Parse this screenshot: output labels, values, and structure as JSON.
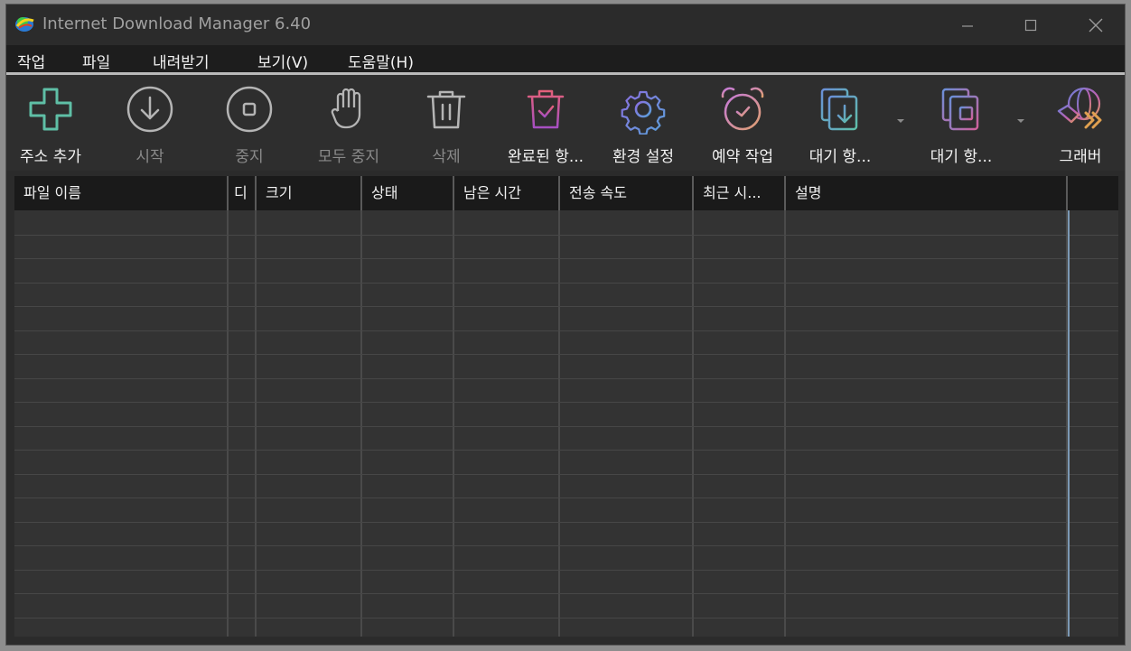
{
  "window": {
    "title": "Internet Download Manager 6.40",
    "minimize_icon": "minimize-icon",
    "maximize_icon": "maximize-icon",
    "close_icon": "close-icon"
  },
  "menu": {
    "items": [
      "작업",
      "파일",
      "내려받기",
      "보기(V)",
      "도움말(H)"
    ]
  },
  "toolbar": {
    "buttons": [
      {
        "label": "주소 추가",
        "icon": "plus-icon",
        "enabled": true,
        "color": "#5fbfa6"
      },
      {
        "label": "시작",
        "icon": "download-circle-icon",
        "enabled": false,
        "color": "#a6a6a6"
      },
      {
        "label": "중지",
        "icon": "stop-circle-icon",
        "enabled": false,
        "color": "#a6a6a6"
      },
      {
        "label": "모두 중지",
        "icon": "hand-icon",
        "enabled": false,
        "color": "#a6a6a6"
      },
      {
        "label": "삭제",
        "icon": "trash-icon",
        "enabled": false,
        "color": "#a6a6a6"
      },
      {
        "label": "완료된 항...",
        "icon": "trash-check-icon",
        "enabled": true,
        "color": "#d25c8a"
      },
      {
        "label": "환경 설정",
        "icon": "gear-icon",
        "enabled": true,
        "color": "#7c6fd8"
      },
      {
        "label": "예약 작업",
        "icon": "alarm-clock-icon",
        "enabled": true,
        "color": "#c07fd0"
      },
      {
        "label": "대기 항...",
        "icon": "queue-start-icon",
        "enabled": true,
        "color": "#5fa9c9"
      },
      {
        "label": "대기 항...",
        "icon": "queue-stop-icon",
        "enabled": true,
        "color": "#c46aa8"
      },
      {
        "label": "그래버",
        "icon": "grabber-icon",
        "enabled": true,
        "color": "#9a7fd6"
      }
    ]
  },
  "table": {
    "columns": [
      "파일 이름",
      "디",
      "크기",
      "상태",
      "남은 시간",
      "전송 속도",
      "최근 시...",
      "설명",
      ""
    ],
    "rows": []
  },
  "colors": {
    "background": "#2b2b2b",
    "menubar": "#1d1d1d",
    "header": "#1a1a1a",
    "accent_blue": "#7c99b5"
  }
}
